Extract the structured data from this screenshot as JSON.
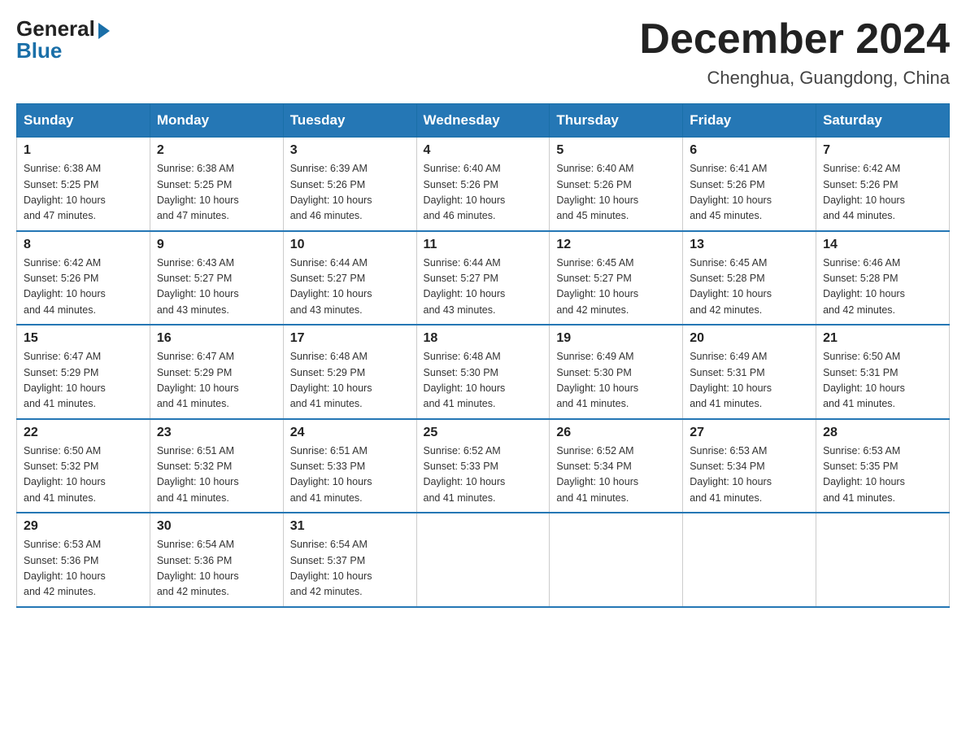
{
  "logo": {
    "general": "General",
    "blue": "Blue"
  },
  "title": "December 2024",
  "location": "Chenghua, Guangdong, China",
  "days_of_week": [
    "Sunday",
    "Monday",
    "Tuesday",
    "Wednesday",
    "Thursday",
    "Friday",
    "Saturday"
  ],
  "weeks": [
    [
      {
        "day": "1",
        "sunrise": "6:38 AM",
        "sunset": "5:25 PM",
        "daylight": "10 hours and 47 minutes."
      },
      {
        "day": "2",
        "sunrise": "6:38 AM",
        "sunset": "5:25 PM",
        "daylight": "10 hours and 47 minutes."
      },
      {
        "day": "3",
        "sunrise": "6:39 AM",
        "sunset": "5:26 PM",
        "daylight": "10 hours and 46 minutes."
      },
      {
        "day": "4",
        "sunrise": "6:40 AM",
        "sunset": "5:26 PM",
        "daylight": "10 hours and 46 minutes."
      },
      {
        "day": "5",
        "sunrise": "6:40 AM",
        "sunset": "5:26 PM",
        "daylight": "10 hours and 45 minutes."
      },
      {
        "day": "6",
        "sunrise": "6:41 AM",
        "sunset": "5:26 PM",
        "daylight": "10 hours and 45 minutes."
      },
      {
        "day": "7",
        "sunrise": "6:42 AM",
        "sunset": "5:26 PM",
        "daylight": "10 hours and 44 minutes."
      }
    ],
    [
      {
        "day": "8",
        "sunrise": "6:42 AM",
        "sunset": "5:26 PM",
        "daylight": "10 hours and 44 minutes."
      },
      {
        "day": "9",
        "sunrise": "6:43 AM",
        "sunset": "5:27 PM",
        "daylight": "10 hours and 43 minutes."
      },
      {
        "day": "10",
        "sunrise": "6:44 AM",
        "sunset": "5:27 PM",
        "daylight": "10 hours and 43 minutes."
      },
      {
        "day": "11",
        "sunrise": "6:44 AM",
        "sunset": "5:27 PM",
        "daylight": "10 hours and 43 minutes."
      },
      {
        "day": "12",
        "sunrise": "6:45 AM",
        "sunset": "5:27 PM",
        "daylight": "10 hours and 42 minutes."
      },
      {
        "day": "13",
        "sunrise": "6:45 AM",
        "sunset": "5:28 PM",
        "daylight": "10 hours and 42 minutes."
      },
      {
        "day": "14",
        "sunrise": "6:46 AM",
        "sunset": "5:28 PM",
        "daylight": "10 hours and 42 minutes."
      }
    ],
    [
      {
        "day": "15",
        "sunrise": "6:47 AM",
        "sunset": "5:29 PM",
        "daylight": "10 hours and 41 minutes."
      },
      {
        "day": "16",
        "sunrise": "6:47 AM",
        "sunset": "5:29 PM",
        "daylight": "10 hours and 41 minutes."
      },
      {
        "day": "17",
        "sunrise": "6:48 AM",
        "sunset": "5:29 PM",
        "daylight": "10 hours and 41 minutes."
      },
      {
        "day": "18",
        "sunrise": "6:48 AM",
        "sunset": "5:30 PM",
        "daylight": "10 hours and 41 minutes."
      },
      {
        "day": "19",
        "sunrise": "6:49 AM",
        "sunset": "5:30 PM",
        "daylight": "10 hours and 41 minutes."
      },
      {
        "day": "20",
        "sunrise": "6:49 AM",
        "sunset": "5:31 PM",
        "daylight": "10 hours and 41 minutes."
      },
      {
        "day": "21",
        "sunrise": "6:50 AM",
        "sunset": "5:31 PM",
        "daylight": "10 hours and 41 minutes."
      }
    ],
    [
      {
        "day": "22",
        "sunrise": "6:50 AM",
        "sunset": "5:32 PM",
        "daylight": "10 hours and 41 minutes."
      },
      {
        "day": "23",
        "sunrise": "6:51 AM",
        "sunset": "5:32 PM",
        "daylight": "10 hours and 41 minutes."
      },
      {
        "day": "24",
        "sunrise": "6:51 AM",
        "sunset": "5:33 PM",
        "daylight": "10 hours and 41 minutes."
      },
      {
        "day": "25",
        "sunrise": "6:52 AM",
        "sunset": "5:33 PM",
        "daylight": "10 hours and 41 minutes."
      },
      {
        "day": "26",
        "sunrise": "6:52 AM",
        "sunset": "5:34 PM",
        "daylight": "10 hours and 41 minutes."
      },
      {
        "day": "27",
        "sunrise": "6:53 AM",
        "sunset": "5:34 PM",
        "daylight": "10 hours and 41 minutes."
      },
      {
        "day": "28",
        "sunrise": "6:53 AM",
        "sunset": "5:35 PM",
        "daylight": "10 hours and 41 minutes."
      }
    ],
    [
      {
        "day": "29",
        "sunrise": "6:53 AM",
        "sunset": "5:36 PM",
        "daylight": "10 hours and 42 minutes."
      },
      {
        "day": "30",
        "sunrise": "6:54 AM",
        "sunset": "5:36 PM",
        "daylight": "10 hours and 42 minutes."
      },
      {
        "day": "31",
        "sunrise": "6:54 AM",
        "sunset": "5:37 PM",
        "daylight": "10 hours and 42 minutes."
      },
      null,
      null,
      null,
      null
    ]
  ],
  "labels": {
    "sunrise": "Sunrise:",
    "sunset": "Sunset:",
    "daylight": "Daylight:"
  }
}
